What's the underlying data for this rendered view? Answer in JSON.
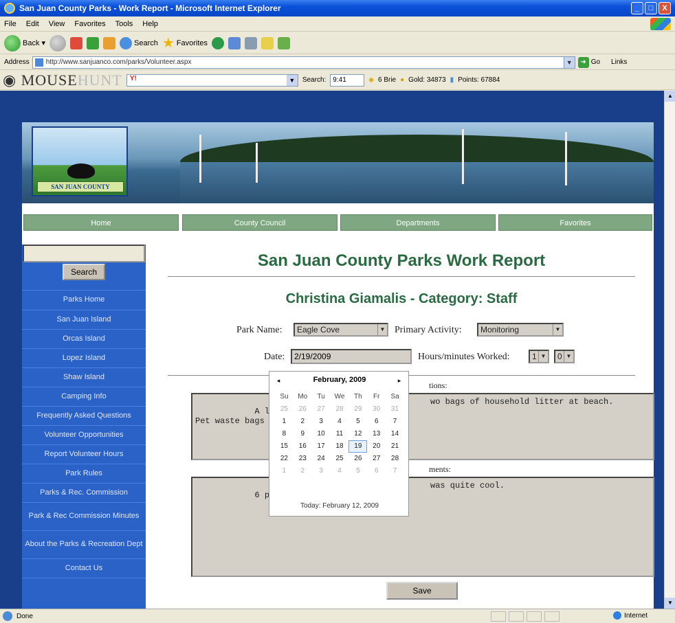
{
  "window": {
    "title": "San Juan County Parks - Work Report - Microsoft Internet Explorer",
    "minimize": "_",
    "maximize": "□",
    "close": "X"
  },
  "menu": [
    "File",
    "Edit",
    "View",
    "Favorites",
    "Tools",
    "Help"
  ],
  "toolbar": {
    "back_label": "Back",
    "search_label": "Search",
    "favorites_label": "Favorites"
  },
  "address": {
    "label": "Address",
    "url": "http://www.sanjuanco.com/parks/Volunteer.aspx",
    "go_label": "Go",
    "links_label": "Links"
  },
  "mousehunt": {
    "logo_main": "MOUSE",
    "logo_light": "HUNT",
    "search_label": "Search:",
    "time": "9:41",
    "brie": "6 Brie",
    "gold": "Gold: 34873",
    "points": "Points: 67884"
  },
  "site": {
    "logo_text": "SAN JUAN COUNTY",
    "nav": [
      "Home",
      "County Council",
      "Departments",
      "Favorites"
    ],
    "sidebar": {
      "search_button": "Search",
      "items": [
        "Parks Home",
        "San Juan Island",
        "Orcas Island",
        "Lopez Island",
        "Shaw Island",
        "Camping Info",
        "Frequently Asked Questions",
        "Volunteer Opportunities",
        "Report Volunteer Hours",
        "Park Rules",
        "Parks & Rec. Commission",
        "Park & Rec Commission Minutes",
        "About the Parks & Recreation Dept",
        "Contact Us"
      ]
    },
    "form": {
      "title": "San Juan County Parks Work Report",
      "subtitle": "Christina Giamalis - Category: Staff",
      "park_name_label": "Park Name:",
      "park_name_value": "Eagle Cove",
      "primary_activity_label": "Primary Activity:",
      "primary_activity_value": "Monitoring",
      "date_label": "Date:",
      "date_value": "2/19/2009",
      "hours_label": "Hours/minutes Worked:",
      "hours_value": "1",
      "minutes_value": "0",
      "observations_label_tail": "tions:",
      "observations_left": "A lot of litter\nPet waste bags",
      "observations_right": "wo bags of household litter at beach.",
      "comments_label_tail": "ments:",
      "comments_left": "6 people at bea",
      "comments_right": "was quite cool.",
      "save_label": "Save"
    },
    "calendar": {
      "month_label": "February, 2009",
      "prev": "◂",
      "next": "▸",
      "days_of_week": [
        "Su",
        "Mo",
        "Tu",
        "We",
        "Th",
        "Fr",
        "Sa"
      ],
      "weeks": [
        [
          "25",
          "26",
          "27",
          "28",
          "29",
          "30",
          "31"
        ],
        [
          "1",
          "2",
          "3",
          "4",
          "5",
          "6",
          "7"
        ],
        [
          "8",
          "9",
          "10",
          "11",
          "12",
          "13",
          "14"
        ],
        [
          "15",
          "16",
          "17",
          "18",
          "19",
          "20",
          "21"
        ],
        [
          "22",
          "23",
          "24",
          "25",
          "26",
          "27",
          "28"
        ],
        [
          "1",
          "2",
          "3",
          "4",
          "5",
          "6",
          "7"
        ]
      ],
      "selected_day": "19",
      "today_label": "Today: February 12, 2009"
    }
  },
  "status": {
    "text": "Done",
    "zone": "Internet"
  }
}
